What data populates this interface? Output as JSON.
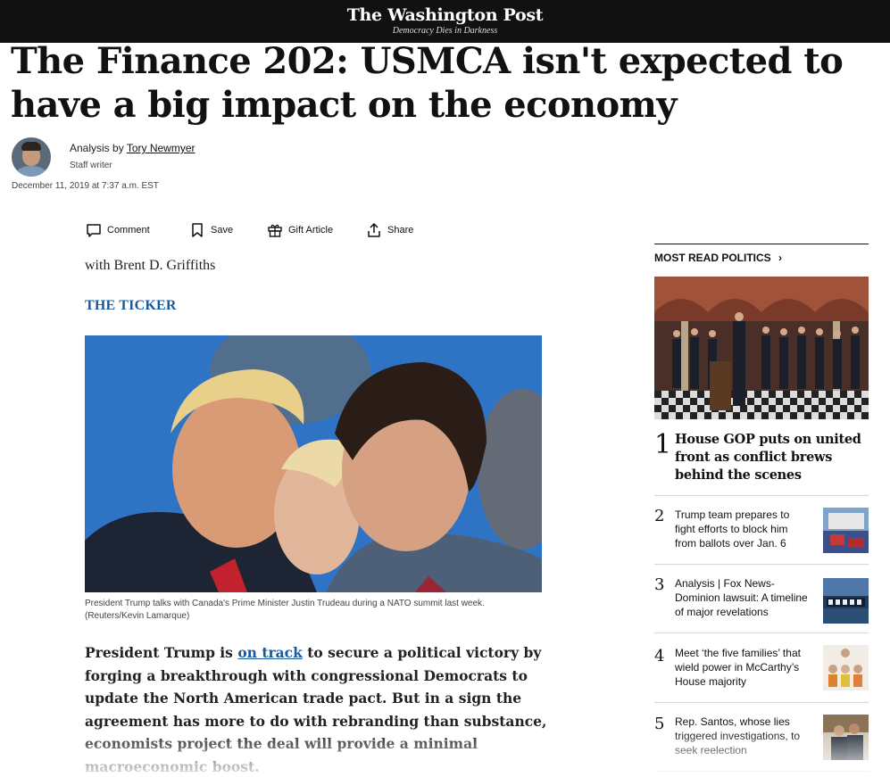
{
  "masthead": {
    "name": "The Washington Post",
    "tagline": "Democracy Dies in Darkness"
  },
  "headline": {
    "line1": "The Finance 202: USMCA isn't expected to",
    "line2": "have a big impact on the economy"
  },
  "byline": {
    "prefix": "Analysis by ",
    "author": "Tory Newmyer",
    "role": "Staff writer",
    "date": "December 11, 2019 at 7:37 a.m. EST"
  },
  "actions": {
    "comment": "Comment",
    "save": "Save",
    "gift": "Gift Article",
    "share": "Share"
  },
  "article": {
    "with": "with Brent D. Griffiths",
    "section": "THE TICKER",
    "caption": "President Trump talks with Canada's Prime Minister Justin Trudeau during a NATO summit last week. (Reuters/Kevin Lamarque)",
    "lede_before": "President Trump is ",
    "lede_link": "on track",
    "lede_after": " to secure a political victory by forging a breakthrough with congressional Democrats to update the North American trade pact. But in a sign the agreement has more to do with rebranding than substance, economists project the deal will provide a minimal macroeconomic boost."
  },
  "sidebar": {
    "heading": "MOST READ POLITICS",
    "chevron": "›",
    "items": [
      {
        "num": "1",
        "title": "House GOP puts on united front as conflict brews behind the scenes"
      },
      {
        "num": "2",
        "title": "Trump team prepares to fight efforts to block him from ballots over Jan. 6"
      },
      {
        "num": "3",
        "label": "Analysis",
        "sep": " | ",
        "title": "Fox News-Dominion lawsuit: A timeline of major revelations"
      },
      {
        "num": "4",
        "title": "Meet ‘the five families’ that wield power in McCarthy’s House majority"
      },
      {
        "num": "5",
        "title": "Rep. Santos, whose lies triggered investigations, to seek reelection"
      }
    ]
  },
  "icons": [
    "comment-icon",
    "bookmark-icon",
    "gift-icon",
    "share-icon",
    "chevron-right-icon"
  ],
  "colors": {
    "topbar": "#111111",
    "link_blue": "#1a5a9c",
    "text": "#111111"
  }
}
